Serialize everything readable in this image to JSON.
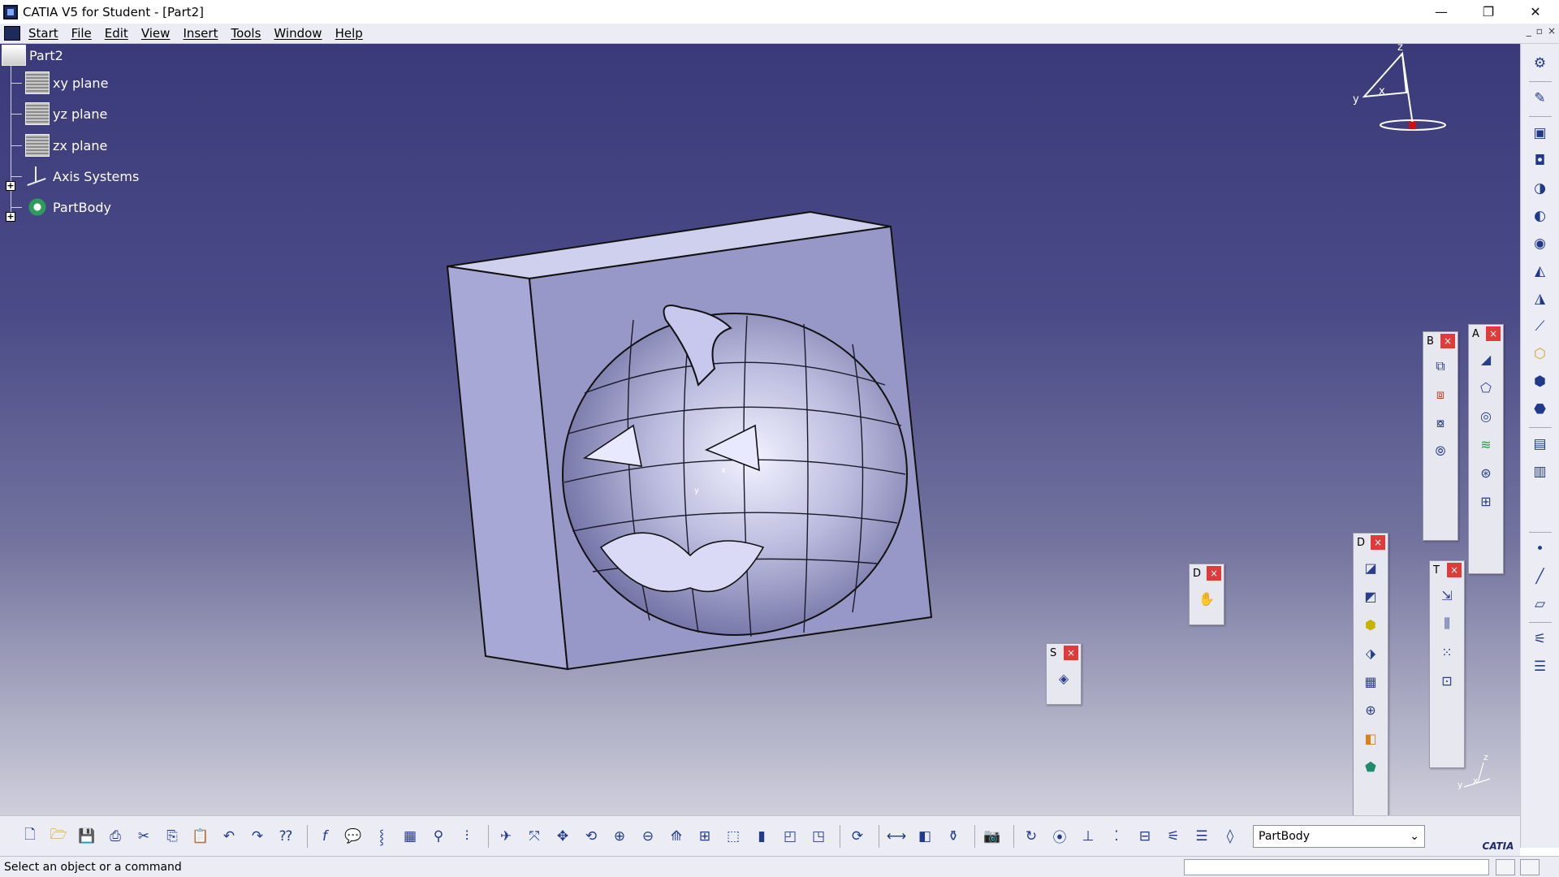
{
  "window": {
    "title": "CATIA V5 for Student - [Part2]",
    "minimize": "—",
    "restore": "❐",
    "close": "✕"
  },
  "menu": {
    "items": [
      "Start",
      "File",
      "Edit",
      "View",
      "Insert",
      "Tools",
      "Window",
      "Help"
    ]
  },
  "tree": {
    "root": "Part2",
    "items": [
      "xy plane",
      "yz plane",
      "zx plane",
      "Axis Systems",
      "PartBody"
    ]
  },
  "compass": {
    "z": "z",
    "y": "y",
    "x": "x"
  },
  "float_toolbars": {
    "s": {
      "letter": "S"
    },
    "d1": {
      "letter": "D"
    },
    "d2": {
      "letter": "D"
    },
    "t": {
      "letter": "T"
    },
    "b": {
      "letter": "B"
    },
    "a": {
      "letter": "A"
    },
    "close": "×"
  },
  "bottom_toolbar": {
    "current_body": "PartBody",
    "combo_arrow": "⌄",
    "logo": "CATIA"
  },
  "status": {
    "message": "Select an object or a command"
  },
  "axis_triad": {
    "z": "z",
    "y": "y",
    "x": "x"
  }
}
